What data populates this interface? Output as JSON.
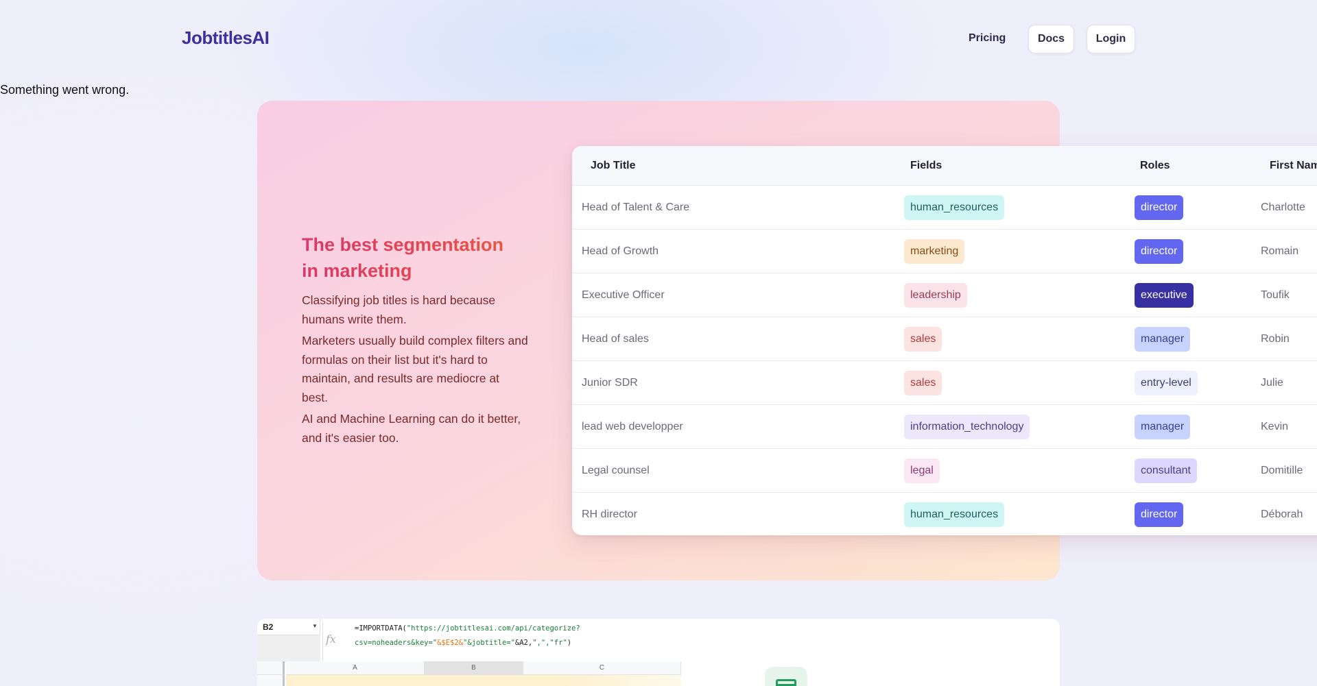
{
  "nav": {
    "logo": "JobtitlesAI",
    "pricing": "Pricing",
    "docs": "Docs",
    "login": "Login"
  },
  "error": "Something went wrong.",
  "hero": {
    "title_line1": "The best segmentation",
    "title_line2": "in marketing",
    "paragraphs": [
      "Classifying job titles is hard because humans write them.",
      "Marketers usually build complex filters and formulas on their list but it's hard to maintain, and results are mediocre at best.",
      "AI and Machine Learning can do it better, and it's easier too."
    ]
  },
  "table": {
    "headers": {
      "job": "Job Title",
      "fields": "Fields",
      "roles": "Roles",
      "first": "First Nam"
    },
    "rows": [
      {
        "job": "Head of Talent & Care",
        "field": "human_resources",
        "role": "director",
        "first": "Charlotte"
      },
      {
        "job": "Head of Growth",
        "field": "marketing",
        "role": "director",
        "first": "Romain"
      },
      {
        "job": "Executive Officer",
        "field": "leadership",
        "role": "executive",
        "first": "Toufik"
      },
      {
        "job": "Head of sales",
        "field": "sales",
        "role": "manager",
        "first": "Robin"
      },
      {
        "job": "Junior SDR",
        "field": "sales",
        "role": "entry-level",
        "first": "Julie"
      },
      {
        "job": "lead web developper",
        "field": "information_technology",
        "role": "manager",
        "first": "Kevin"
      },
      {
        "job": "Legal counsel",
        "field": "legal",
        "role": "consultant",
        "first": "Domitille"
      },
      {
        "job": "RH director",
        "field": "human_resources",
        "role": "director",
        "first": "Déborah"
      }
    ],
    "field_colors": {
      "human_resources": {
        "bg": "#cff6f5",
        "fg": "#1f5e63"
      },
      "marketing": {
        "bg": "#fde9cf",
        "fg": "#8a4a12"
      },
      "leadership": {
        "bg": "#fbe3ea",
        "fg": "#9b3b52"
      },
      "sales": {
        "bg": "#fde2e2",
        "fg": "#b33a3a"
      },
      "information_technology": {
        "bg": "#ece7fb",
        "fg": "#4c3f87"
      },
      "legal": {
        "bg": "#fbe6f4",
        "fg": "#8c3a77"
      }
    },
    "role_colors": {
      "director": {
        "bg": "#6366f1",
        "fg": "#ffffff"
      },
      "executive": {
        "bg": "#3730a3",
        "fg": "#ffffff"
      },
      "manager": {
        "bg": "#c7d2fe",
        "fg": "#3b3f8f"
      },
      "entry-level": {
        "bg": "#eef0fd",
        "fg": "#3b3f6f"
      },
      "consultant": {
        "bg": "#ddd6fe",
        "fg": "#4c3f87"
      }
    }
  },
  "sheet": {
    "cell_ref": "B2",
    "fx": "fx",
    "formula_line1_prefix": "=IMPORTDATA(",
    "formula_line1_url": "\"https://jobtitlesai.com/api/categorize?",
    "formula_line2_a": "csv=noheaders&key=\"",
    "formula_line2_b": "&$E$2&",
    "formula_line2_c": "\"&jobtitle=\"",
    "formula_line2_d": "&A2,",
    "formula_line2_e": "\",\",\"fr\"",
    "formula_line2_f": ")",
    "col_a": "A",
    "col_b": "B",
    "col_c": "C"
  }
}
